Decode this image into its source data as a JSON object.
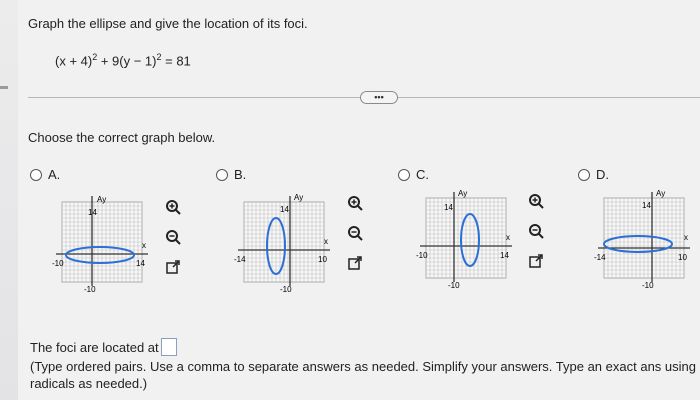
{
  "question": {
    "prompt": "Graph the ellipse and give the location of its foci.",
    "equation": {
      "lhs_a": "(x + 4)",
      "exp_a": "2",
      "mid": " + 9(y − 1)",
      "exp_b": "2",
      "rhs": " = 81"
    }
  },
  "more_button": {
    "label": "•••"
  },
  "choose_label": "Choose the correct graph below.",
  "options": [
    {
      "letter": "A.",
      "graph": {
        "y_top": "14",
        "x_right": "x",
        "x_min": "-10",
        "x_max": "14",
        "y_min": "-10",
        "y_label": "Ay"
      }
    },
    {
      "letter": "B.",
      "graph": {
        "y_top": "14",
        "x_right": "x",
        "x_min": "-14",
        "x_max": "10",
        "y_min": "-10",
        "y_label": "Ay"
      }
    },
    {
      "letter": "C.",
      "graph": {
        "y_top": "14",
        "x_right": "x",
        "x_min": "-10",
        "x_max": "14",
        "y_min": "-10",
        "y_label": "Ay"
      }
    },
    {
      "letter": "D.",
      "graph": {
        "y_top": "14",
        "x_right": "x",
        "x_min": "-14",
        "x_max": "10",
        "y_min": "-10",
        "y_label": "Ay"
      }
    }
  ],
  "icons": {
    "zoom_in": "zoom-in-icon",
    "zoom_out": "zoom-out-icon",
    "expand": "expand-icon"
  },
  "answer": {
    "foci_label": "The foci are located at",
    "foci_value": "",
    "hint": "(Type ordered pairs. Use a comma to separate answers as needed. Simplify your answers. Type an exact ans using radicals as needed.)"
  },
  "colors": {
    "ellipse": "#2c6fd6",
    "grid": "#bdbdbd",
    "axis": "#333333"
  }
}
